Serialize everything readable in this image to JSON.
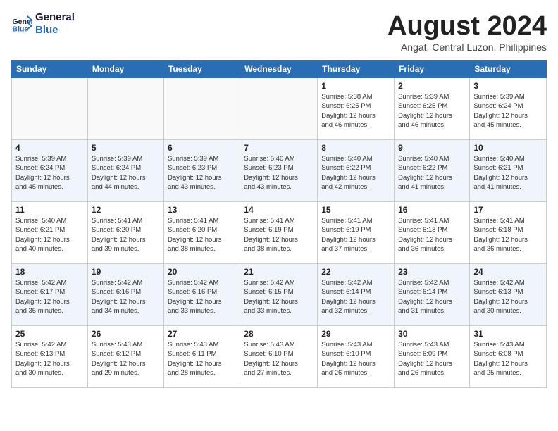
{
  "header": {
    "logo_line1": "General",
    "logo_line2": "Blue",
    "month": "August 2024",
    "location": "Angat, Central Luzon, Philippines"
  },
  "weekdays": [
    "Sunday",
    "Monday",
    "Tuesday",
    "Wednesday",
    "Thursday",
    "Friday",
    "Saturday"
  ],
  "weeks": [
    [
      {
        "day": "",
        "info": ""
      },
      {
        "day": "",
        "info": ""
      },
      {
        "day": "",
        "info": ""
      },
      {
        "day": "",
        "info": ""
      },
      {
        "day": "1",
        "info": "Sunrise: 5:38 AM\nSunset: 6:25 PM\nDaylight: 12 hours\nand 46 minutes."
      },
      {
        "day": "2",
        "info": "Sunrise: 5:39 AM\nSunset: 6:25 PM\nDaylight: 12 hours\nand 46 minutes."
      },
      {
        "day": "3",
        "info": "Sunrise: 5:39 AM\nSunset: 6:24 PM\nDaylight: 12 hours\nand 45 minutes."
      }
    ],
    [
      {
        "day": "4",
        "info": "Sunrise: 5:39 AM\nSunset: 6:24 PM\nDaylight: 12 hours\nand 45 minutes."
      },
      {
        "day": "5",
        "info": "Sunrise: 5:39 AM\nSunset: 6:24 PM\nDaylight: 12 hours\nand 44 minutes."
      },
      {
        "day": "6",
        "info": "Sunrise: 5:39 AM\nSunset: 6:23 PM\nDaylight: 12 hours\nand 43 minutes."
      },
      {
        "day": "7",
        "info": "Sunrise: 5:40 AM\nSunset: 6:23 PM\nDaylight: 12 hours\nand 43 minutes."
      },
      {
        "day": "8",
        "info": "Sunrise: 5:40 AM\nSunset: 6:22 PM\nDaylight: 12 hours\nand 42 minutes."
      },
      {
        "day": "9",
        "info": "Sunrise: 5:40 AM\nSunset: 6:22 PM\nDaylight: 12 hours\nand 41 minutes."
      },
      {
        "day": "10",
        "info": "Sunrise: 5:40 AM\nSunset: 6:21 PM\nDaylight: 12 hours\nand 41 minutes."
      }
    ],
    [
      {
        "day": "11",
        "info": "Sunrise: 5:40 AM\nSunset: 6:21 PM\nDaylight: 12 hours\nand 40 minutes."
      },
      {
        "day": "12",
        "info": "Sunrise: 5:41 AM\nSunset: 6:20 PM\nDaylight: 12 hours\nand 39 minutes."
      },
      {
        "day": "13",
        "info": "Sunrise: 5:41 AM\nSunset: 6:20 PM\nDaylight: 12 hours\nand 38 minutes."
      },
      {
        "day": "14",
        "info": "Sunrise: 5:41 AM\nSunset: 6:19 PM\nDaylight: 12 hours\nand 38 minutes."
      },
      {
        "day": "15",
        "info": "Sunrise: 5:41 AM\nSunset: 6:19 PM\nDaylight: 12 hours\nand 37 minutes."
      },
      {
        "day": "16",
        "info": "Sunrise: 5:41 AM\nSunset: 6:18 PM\nDaylight: 12 hours\nand 36 minutes."
      },
      {
        "day": "17",
        "info": "Sunrise: 5:41 AM\nSunset: 6:18 PM\nDaylight: 12 hours\nand 36 minutes."
      }
    ],
    [
      {
        "day": "18",
        "info": "Sunrise: 5:42 AM\nSunset: 6:17 PM\nDaylight: 12 hours\nand 35 minutes."
      },
      {
        "day": "19",
        "info": "Sunrise: 5:42 AM\nSunset: 6:16 PM\nDaylight: 12 hours\nand 34 minutes."
      },
      {
        "day": "20",
        "info": "Sunrise: 5:42 AM\nSunset: 6:16 PM\nDaylight: 12 hours\nand 33 minutes."
      },
      {
        "day": "21",
        "info": "Sunrise: 5:42 AM\nSunset: 6:15 PM\nDaylight: 12 hours\nand 33 minutes."
      },
      {
        "day": "22",
        "info": "Sunrise: 5:42 AM\nSunset: 6:14 PM\nDaylight: 12 hours\nand 32 minutes."
      },
      {
        "day": "23",
        "info": "Sunrise: 5:42 AM\nSunset: 6:14 PM\nDaylight: 12 hours\nand 31 minutes."
      },
      {
        "day": "24",
        "info": "Sunrise: 5:42 AM\nSunset: 6:13 PM\nDaylight: 12 hours\nand 30 minutes."
      }
    ],
    [
      {
        "day": "25",
        "info": "Sunrise: 5:42 AM\nSunset: 6:13 PM\nDaylight: 12 hours\nand 30 minutes."
      },
      {
        "day": "26",
        "info": "Sunrise: 5:43 AM\nSunset: 6:12 PM\nDaylight: 12 hours\nand 29 minutes."
      },
      {
        "day": "27",
        "info": "Sunrise: 5:43 AM\nSunset: 6:11 PM\nDaylight: 12 hours\nand 28 minutes."
      },
      {
        "day": "28",
        "info": "Sunrise: 5:43 AM\nSunset: 6:10 PM\nDaylight: 12 hours\nand 27 minutes."
      },
      {
        "day": "29",
        "info": "Sunrise: 5:43 AM\nSunset: 6:10 PM\nDaylight: 12 hours\nand 26 minutes."
      },
      {
        "day": "30",
        "info": "Sunrise: 5:43 AM\nSunset: 6:09 PM\nDaylight: 12 hours\nand 26 minutes."
      },
      {
        "day": "31",
        "info": "Sunrise: 5:43 AM\nSunset: 6:08 PM\nDaylight: 12 hours\nand 25 minutes."
      }
    ]
  ]
}
